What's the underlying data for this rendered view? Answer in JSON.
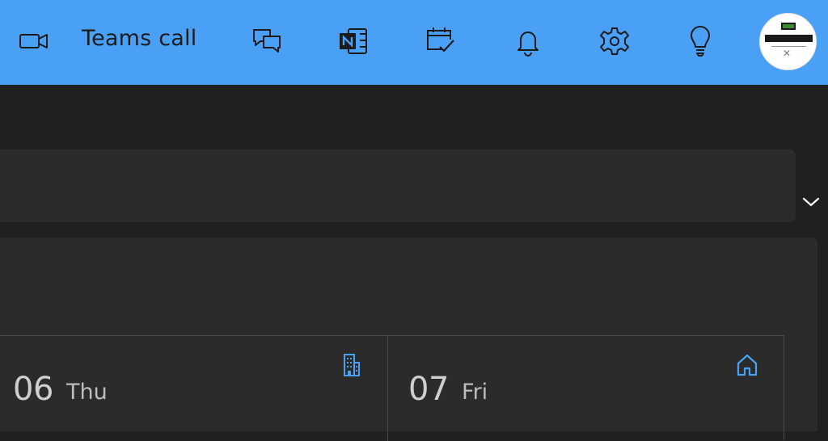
{
  "topbar": {
    "video_icon": "video-camera-icon",
    "teams_call_label": "Teams call",
    "icons": [
      "chat-icon",
      "onenote-icon",
      "calendar-check-icon",
      "bell-icon",
      "gear-icon",
      "lightbulb-icon"
    ],
    "avatar": "avatar"
  },
  "calendar": {
    "days": [
      {
        "number": "06",
        "name": "Thu",
        "location_icon": "building-icon"
      },
      {
        "number": "07",
        "name": "Fri",
        "location_icon": "home-icon"
      }
    ]
  },
  "colors": {
    "topbar_bg": "#4aa0f5",
    "app_bg": "#202020",
    "panel_bg": "#2b2b2b",
    "accent_icon": "#4aa0f5"
  }
}
